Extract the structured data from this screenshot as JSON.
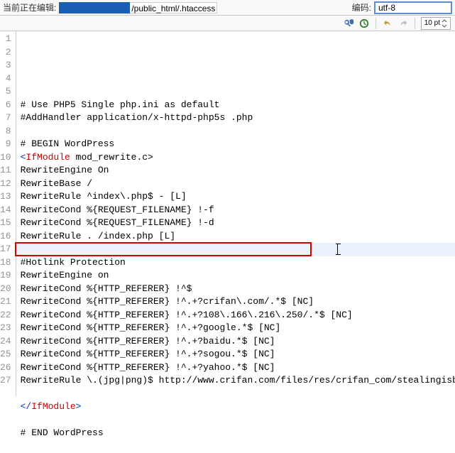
{
  "topbar": {
    "editing_label": "当前正在编辑:",
    "path_suffix": "/public_html/.htaccess",
    "encoding_label": "编码:",
    "encoding_value": "utf-8"
  },
  "toolbar": {
    "fontsize": "10 pt"
  },
  "lines": [
    {
      "n": 1,
      "text": "# Use PHP5 Single php.ini as default"
    },
    {
      "n": 2,
      "text": "#AddHandler application/x-httpd-php5s .php"
    },
    {
      "n": 3,
      "text": ""
    },
    {
      "n": 4,
      "text": "# BEGIN WordPress"
    },
    {
      "n": 5,
      "segs": [
        {
          "t": "<",
          "c": "blue"
        },
        {
          "t": "IfModule",
          "c": "red"
        },
        {
          "t": " mod_rewrite.c>"
        }
      ]
    },
    {
      "n": 6,
      "text": "RewriteEngine On"
    },
    {
      "n": 7,
      "text": "RewriteBase /"
    },
    {
      "n": 8,
      "text": "RewriteRule ^index\\.php$ - [L]"
    },
    {
      "n": 9,
      "text": "RewriteCond %{REQUEST_FILENAME} !-f"
    },
    {
      "n": 10,
      "text": "RewriteCond %{REQUEST_FILENAME} !-d"
    },
    {
      "n": 11,
      "text": "RewriteRule . /index.php [L]"
    },
    {
      "n": 12,
      "text": ""
    },
    {
      "n": 13,
      "text": "#Hotlink Protection"
    },
    {
      "n": 14,
      "text": "RewriteEngine on"
    },
    {
      "n": 15,
      "text": "RewriteCond %{HTTP_REFERER} !^$"
    },
    {
      "n": 16,
      "text": "RewriteCond %{HTTP_REFERER} !^.+?crifan\\.com/.*$ [NC]"
    },
    {
      "n": 17,
      "text": "RewriteCond %{HTTP_REFERER} !^.+?108\\.166\\.216\\.250/.*$ [NC]"
    },
    {
      "n": 18,
      "text": "RewriteCond %{HTTP_REFERER} !^.+?google.*$ [NC]"
    },
    {
      "n": 19,
      "text": "RewriteCond %{HTTP_REFERER} !^.+?baidu.*$ [NC]"
    },
    {
      "n": 20,
      "text": "RewriteCond %{HTTP_REFERER} !^.+?sogou.*$ [NC]"
    },
    {
      "n": 21,
      "text": "RewriteCond %{HTTP_REFERER} !^.+?yahoo.*$ [NC]"
    },
    {
      "n": 22,
      "text": "RewriteRule \\.(jpg|png)$ http://www.crifan.com/files/res/crifan_com/stealingisbad.gif [R,L]"
    },
    {
      "n": 23,
      "text": ""
    },
    {
      "n": 24,
      "segs": [
        {
          "t": "</",
          "c": "blue"
        },
        {
          "t": "IfModule",
          "c": "red"
        },
        {
          "t": ">",
          "c": "blue"
        }
      ]
    },
    {
      "n": 25,
      "text": ""
    },
    {
      "n": 26,
      "text": "# END WordPress"
    },
    {
      "n": 27,
      "text": ""
    }
  ],
  "highlight_line": 17,
  "redbox_line": 17
}
